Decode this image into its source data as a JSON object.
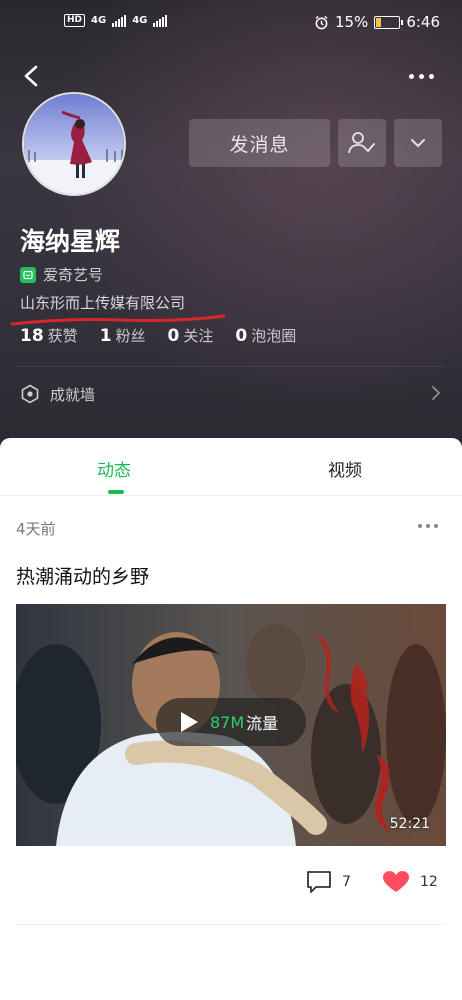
{
  "status_bar": {
    "network_left": "HD",
    "signal1_label": "4G",
    "signal2_label": "4G",
    "battery_percent": "15%",
    "time": "6:46"
  },
  "profile": {
    "name": "海纳星辉",
    "platform": "爱奇艺号",
    "company": "山东形而上传媒有限公司",
    "message_button": "发消息",
    "stats": [
      {
        "value": "18",
        "label": "获赞"
      },
      {
        "value": "1",
        "label": "粉丝"
      },
      {
        "value": "0",
        "label": "关注"
      },
      {
        "value": "0",
        "label": "泡泡圈"
      }
    ],
    "achievement_wall": "成就墙"
  },
  "tabs": [
    {
      "label": "动态",
      "active": true
    },
    {
      "label": "视频",
      "active": false
    }
  ],
  "post": {
    "time": "4天前",
    "title": "热潮涌动的乡野",
    "video": {
      "traffic_value": "87M",
      "traffic_label": "流量",
      "duration": "52:21"
    },
    "comments": "7",
    "likes": "12"
  },
  "colors": {
    "accent": "#19b955",
    "like": "#ff4d5e",
    "header_bg": "#322f37"
  },
  "icons": [
    "back-icon",
    "more-icon",
    "follow-check-icon",
    "chevron-down-icon",
    "platform-icon",
    "achievement-icon",
    "chevron-right-icon",
    "play-icon",
    "comment-icon",
    "heart-icon",
    "alarm-icon",
    "battery-icon"
  ]
}
